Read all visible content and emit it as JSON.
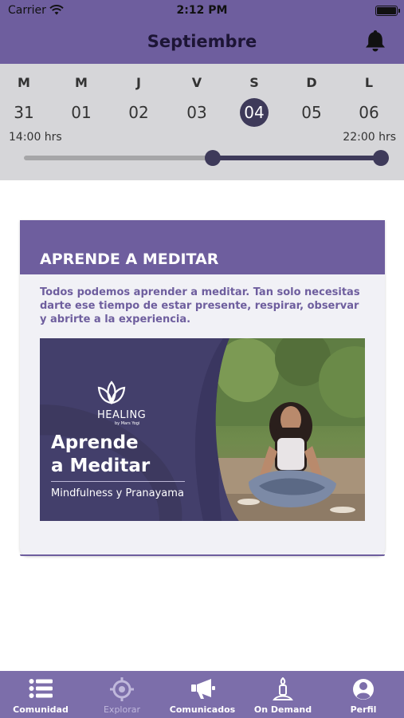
{
  "status_bar": {
    "carrier": "Carrier",
    "time": "2:12 PM"
  },
  "header": {
    "title": "Septiembre"
  },
  "week": {
    "days": [
      {
        "letter": "M",
        "number": "31"
      },
      {
        "letter": "M",
        "number": "01"
      },
      {
        "letter": "J",
        "number": "02"
      },
      {
        "letter": "V",
        "number": "03"
      },
      {
        "letter": "S",
        "number": "04"
      },
      {
        "letter": "D",
        "number": "05"
      },
      {
        "letter": "L",
        "number": "06"
      }
    ],
    "selected_index": 4,
    "range_start_label": "14:00 hrs",
    "range_end_label": "22:00 hrs"
  },
  "card": {
    "title": "APRENDE A MEDITAR",
    "description": "Todos podemos aprender a meditar. Tan solo necesitas darte ese tiempo de estar presente, respirar, observar y abrirte a la experiencia.",
    "banner": {
      "brand": "HEALING",
      "brand_sub": "by Mars Yogi",
      "title_line1": "Aprende",
      "title_line2": "a Meditar",
      "subtitle": "Mindfulness y Pranayama"
    }
  },
  "tabbar": {
    "items": [
      {
        "label": "Comunidad",
        "icon": "list-icon"
      },
      {
        "label": "Explorar",
        "icon": "crosshair-icon"
      },
      {
        "label": "Comunicados",
        "icon": "megaphone-icon"
      },
      {
        "label": "On Demand",
        "icon": "meditation-figure-icon"
      },
      {
        "label": "Perfil",
        "icon": "user-circle-icon"
      }
    ],
    "dimmed_index": 1
  },
  "colors": {
    "header": "#6e5e9e",
    "calendar_bg": "#d6d6d9",
    "selected_day": "#3e3a5a",
    "banner_bg": "#433f6b",
    "tabbar": "#7c6eaa"
  }
}
